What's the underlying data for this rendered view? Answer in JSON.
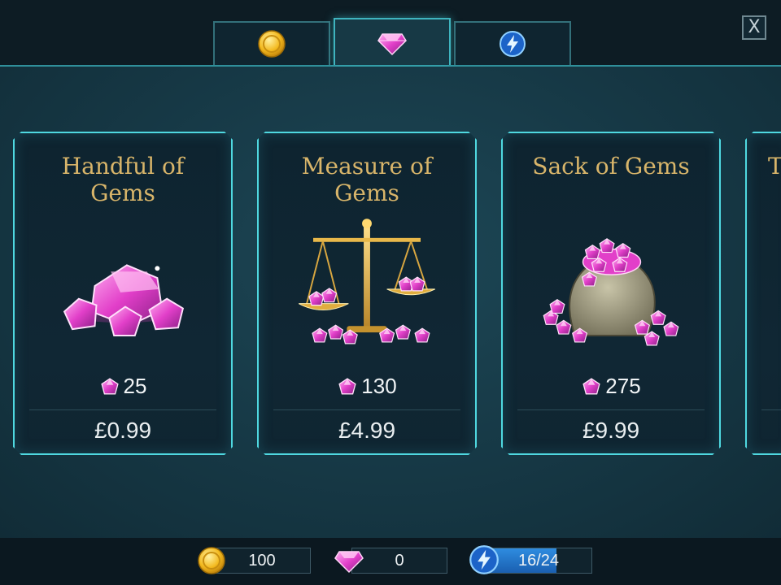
{
  "tabs": [
    {
      "icon": "gold-coin-icon"
    },
    {
      "icon": "pink-gem-icon"
    },
    {
      "icon": "energy-bolt-icon"
    }
  ],
  "close_label": "X",
  "cards": [
    {
      "title": "Handful of Gems",
      "title_line1": "Handful of",
      "title_line2": "Gems",
      "gems": "25",
      "price": "£0.99"
    },
    {
      "title": "Measure of Gems",
      "title_line1": "Measure of",
      "title_line2": "Gems",
      "gems": "130",
      "price": "£4.99"
    },
    {
      "title": "Sack of Gems",
      "title_line1": "Sack of Gems",
      "title_line2": "",
      "gems": "275",
      "price": "£9.99"
    },
    {
      "title_line1": "T"
    }
  ],
  "resources": {
    "coins": "100",
    "gems": "0",
    "energy": "16/24",
    "energy_fraction": 0.667
  },
  "colors": {
    "accent": "#4fd8e0",
    "title_gold": "#d8b56a",
    "gem_pink": "#e23fc9"
  }
}
